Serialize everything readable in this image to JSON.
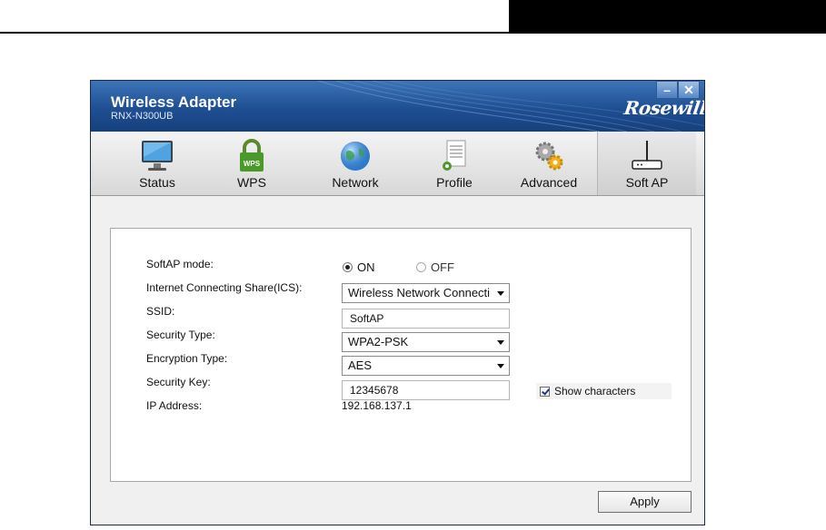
{
  "window": {
    "title": "Wireless Adapter",
    "model": "RNX-N300UB",
    "logo_text": "Rosewill",
    "minimize_glyph": "–",
    "close_glyph": "✕"
  },
  "toolbar": {
    "items": [
      {
        "label": "Status",
        "icon": "monitor-icon"
      },
      {
        "label": "WPS",
        "icon": "wps-lock-icon"
      },
      {
        "label": "Network",
        "icon": "globe-icon"
      },
      {
        "label": "Profile",
        "icon": "profile-document-icon"
      },
      {
        "label": "Advanced",
        "icon": "gears-icon"
      },
      {
        "label": "Soft AP",
        "icon": "router-icon",
        "active": true
      }
    ]
  },
  "form": {
    "softap_mode_label": "SoftAP mode:",
    "radio_on_label": "ON",
    "radio_off_label": "OFF",
    "softap_selected": "ON",
    "ics_label": "Internet Connecting Share(ICS):",
    "ics_value": "Wireless Network Connecti",
    "ssid_label": "SSID:",
    "ssid_value": "SoftAP",
    "security_type_label": "Security Type:",
    "security_type_value": "WPA2-PSK",
    "encryption_type_label": "Encryption Type:",
    "encryption_type_value": "AES",
    "security_key_label": "Security Key:",
    "security_key_value": "12345678",
    "show_characters_label": "Show characters",
    "show_characters_checked": true,
    "ip_address_label": "IP Address:",
    "ip_address_value": "192.168.137.1"
  },
  "actions": {
    "apply_label": "Apply"
  },
  "colors": {
    "titlebar": "#1f4f93",
    "window_bg": "#f0f0f0"
  }
}
